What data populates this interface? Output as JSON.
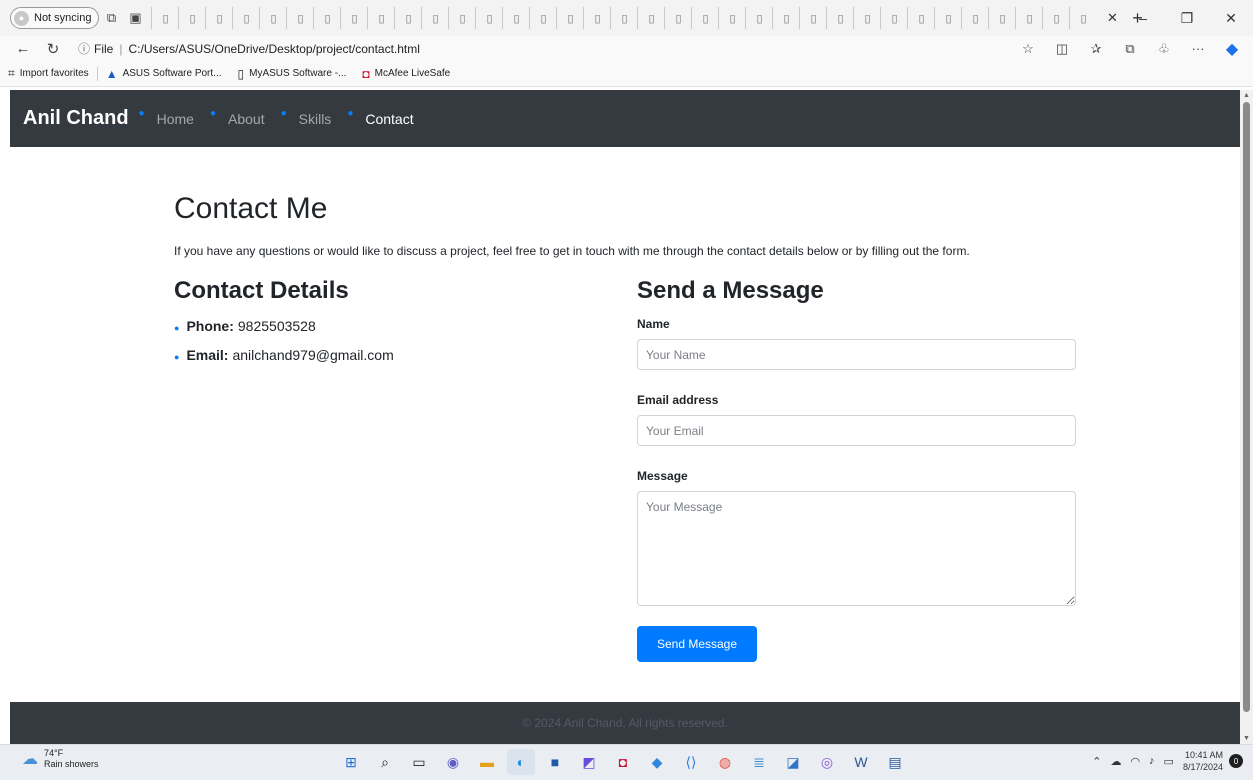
{
  "browser": {
    "profile_label": "Not syncing",
    "url_prefix": "File",
    "url": "C:/Users/ASUS/OneDrive/Desktop/project/contact.html",
    "favorites": [
      {
        "label": "Import favorites",
        "icon": "folder-icon"
      },
      {
        "label": "ASUS Software Port...",
        "icon": "asus-icon"
      },
      {
        "label": "MyASUS Software -...",
        "icon": "page-icon"
      },
      {
        "label": "McAfee LiveSafe",
        "icon": "mcafee-icon"
      }
    ]
  },
  "site": {
    "brand": "Anil Chand",
    "nav": [
      {
        "label": "Home",
        "active": false
      },
      {
        "label": "About",
        "active": false
      },
      {
        "label": "Skills",
        "active": false
      },
      {
        "label": "Contact",
        "active": true
      }
    ],
    "title": "Contact Me",
    "intro": "If you have any questions or would like to discuss a project, feel free to get in touch with me through the contact details below or by filling out the form.",
    "details": {
      "title": "Contact Details",
      "phone_label": "Phone:",
      "phone": "9825503528",
      "email_label": "Email:",
      "email": "anilchand979@gmail.com"
    },
    "form": {
      "title": "Send a Message",
      "name_label": "Name",
      "name_placeholder": "Your Name",
      "email_label": "Email address",
      "email_placeholder": "Your Email",
      "message_label": "Message",
      "message_placeholder": "Your Message",
      "submit": "Send Message"
    },
    "footer": "© 2024 Anil Chand. All rights reserved."
  },
  "taskbar": {
    "temperature": "74°F",
    "weather": "Rain showers",
    "time": "10:41 AM",
    "date": "8/17/2024",
    "notifications": "0"
  },
  "colors": {
    "navbar": "#343a40",
    "accent": "#007bff"
  }
}
